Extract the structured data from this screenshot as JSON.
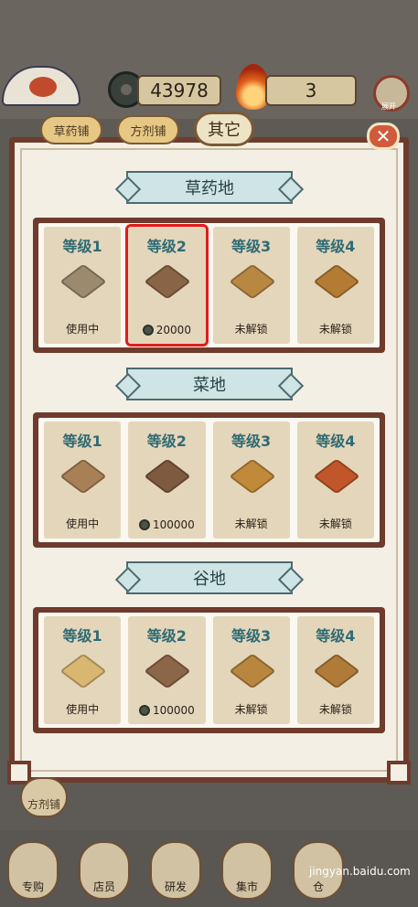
{
  "hud": {
    "coins": "43978",
    "fire": "3"
  },
  "tabs": [
    {
      "label": "草药铺"
    },
    {
      "label": "方剂铺"
    },
    {
      "label": "其它"
    }
  ],
  "close_icon": "close-icon",
  "sections": [
    {
      "title": "草药地",
      "cards": [
        {
          "level": "等级1",
          "status": "使用中",
          "price": "",
          "color": "#9b8a6d"
        },
        {
          "level": "等级2",
          "status": "",
          "price": "20000",
          "color": "#8a6446"
        },
        {
          "level": "等级3",
          "status": "未解锁",
          "price": "",
          "color": "#b88842"
        },
        {
          "level": "等级4",
          "status": "未解锁",
          "price": "",
          "color": "#b47b35"
        }
      ]
    },
    {
      "title": "菜地",
      "cards": [
        {
          "level": "等级1",
          "status": "使用中",
          "price": "",
          "color": "#a88056"
        },
        {
          "level": "等级2",
          "status": "",
          "price": "100000",
          "color": "#7e5a40"
        },
        {
          "level": "等级3",
          "status": "未解锁",
          "price": "",
          "color": "#c08a3a"
        },
        {
          "level": "等级4",
          "status": "未解锁",
          "price": "",
          "color": "#c0562a"
        }
      ]
    },
    {
      "title": "谷地",
      "cards": [
        {
          "level": "等级1",
          "status": "使用中",
          "price": "",
          "color": "#d9b771"
        },
        {
          "level": "等级2",
          "status": "",
          "price": "100000",
          "color": "#8c6648"
        },
        {
          "level": "等级3",
          "status": "未解锁",
          "price": "",
          "color": "#b8863e"
        },
        {
          "level": "等级4",
          "status": "未解锁",
          "price": "",
          "color": "#b07a38"
        }
      ]
    }
  ],
  "side_button": "方剂铺",
  "nav": [
    {
      "label": "专购"
    },
    {
      "label": "店员"
    },
    {
      "label": "研发"
    },
    {
      "label": "集市"
    },
    {
      "label": "仓"
    }
  ],
  "watermark": "jingyan.baidu.com"
}
